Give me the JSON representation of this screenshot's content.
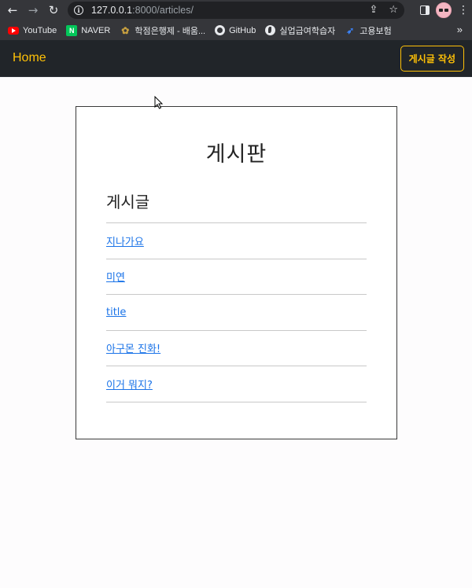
{
  "browser": {
    "url_host": "127.0.0.1",
    "url_rest": ":8000/articles/",
    "bookmarks": [
      {
        "label": "YouTube",
        "icon": "youtube-icon"
      },
      {
        "label": "NAVER",
        "icon": "naver-icon"
      },
      {
        "label": "학점은행제 - 배움...",
        "icon": "tree-icon"
      },
      {
        "label": "GitHub",
        "icon": "github-icon"
      },
      {
        "label": "실업급여학습자",
        "icon": "globe-icon"
      },
      {
        "label": "고용보험",
        "icon": "leaf-icon"
      }
    ],
    "more_label": "»"
  },
  "navbar": {
    "brand": "Home",
    "write_button": "게시글 작성",
    "accent_color": "#ffc107"
  },
  "board": {
    "title": "게시판",
    "section_title": "게시글",
    "articles": [
      {
        "title": "지나가요"
      },
      {
        "title": "미연"
      },
      {
        "title": "title"
      },
      {
        "title": "아구몬 진화!"
      },
      {
        "title": "이거 뭐지?"
      }
    ]
  }
}
